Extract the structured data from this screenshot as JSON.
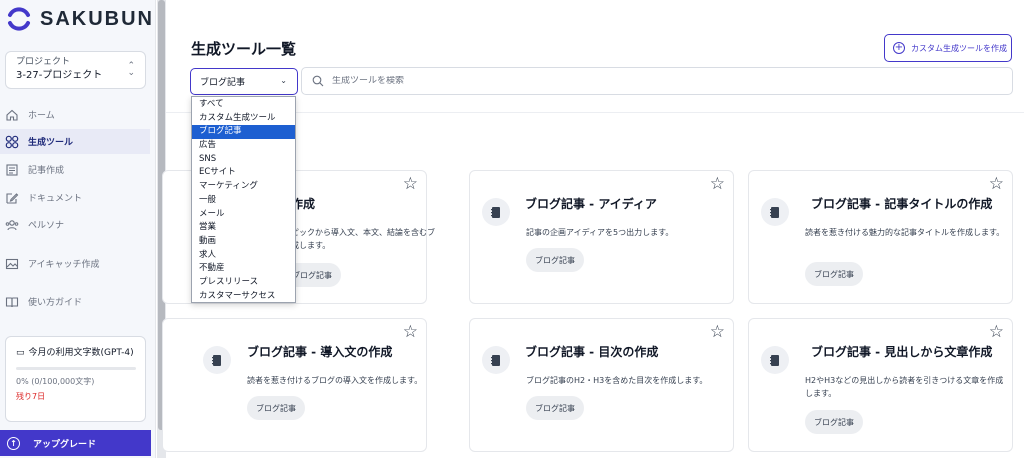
{
  "app": {
    "logo_text": "SAKUBUN"
  },
  "sidebar": {
    "project": {
      "label": "プロジェクト",
      "name": "3-27-プロジェクト"
    },
    "nav": [
      {
        "label": "ホーム",
        "icon": "home-icon"
      },
      {
        "label": "生成ツール",
        "icon": "grid-icon",
        "active": true
      },
      {
        "label": "記事作成",
        "icon": "article-icon"
      },
      {
        "label": "ドキュメント",
        "icon": "edit-icon"
      },
      {
        "label": "ペルソナ",
        "icon": "users-icon"
      },
      {
        "label": "アイキャッチ作成",
        "icon": "image-icon"
      },
      {
        "label": "使い方ガイド",
        "icon": "book-icon"
      }
    ],
    "usage": {
      "title": "今月の利用文字数(GPT-4)",
      "text": "0% (0/100,000文字)",
      "remaining": "残り7日",
      "progress": 0
    },
    "upgrade_label": "アップグレード"
  },
  "main": {
    "title": "生成ツール一覧",
    "custom_button_label": "カスタム生成ツールを作成",
    "filter": {
      "selected": "ブログ記事",
      "options": [
        "すべて",
        "カスタム生成ツール",
        "ブログ記事",
        "広告",
        "SNS",
        "ECサイト",
        "マーケティング",
        "一般",
        "メール",
        "営業",
        "動画",
        "求人",
        "不動産",
        "プレスリリース",
        "カスタマーサクセス"
      ]
    },
    "search_placeholder": "生成ツールを検索",
    "cards": [
      {
        "title": "ブログ記事 - 全文の作成",
        "title_visible": "作成",
        "desc": "トピックから導入文、本文、結論を含むブログ記事を作成します。",
        "desc_line1": "ピックから導入文、本文、結論を含むブ",
        "desc_line2": "成します。",
        "tag": "ブログ記事"
      },
      {
        "title": "ブログ記事 - アイディア",
        "desc": "記事の企画アイディアを5つ出力します。",
        "tag": "ブログ記事"
      },
      {
        "title": "ブログ記事 - 記事タイトルの作成",
        "desc": "読者を惹き付ける魅力的な記事タイトルを作成します。",
        "tag": "ブログ記事"
      },
      {
        "title": "ブログ記事 - 導入文の作成",
        "desc": "読者を惹き付けるブログの導入文を作成します。",
        "tag": "ブログ記事"
      },
      {
        "title": "ブログ記事 - 目次の作成",
        "desc": "ブログ記事のH2・H3を含めた目次を作成します。",
        "tag": "ブログ記事"
      },
      {
        "title": "ブログ記事 - 見出しから文章作成",
        "desc": "H2やH3などの見出しから読者を引きつける文章を作成します。",
        "tag": "ブログ記事"
      }
    ]
  },
  "colors": {
    "accent": "#4338ca",
    "selected_option": "#1d5fd1",
    "remaining": "#dc2626"
  }
}
